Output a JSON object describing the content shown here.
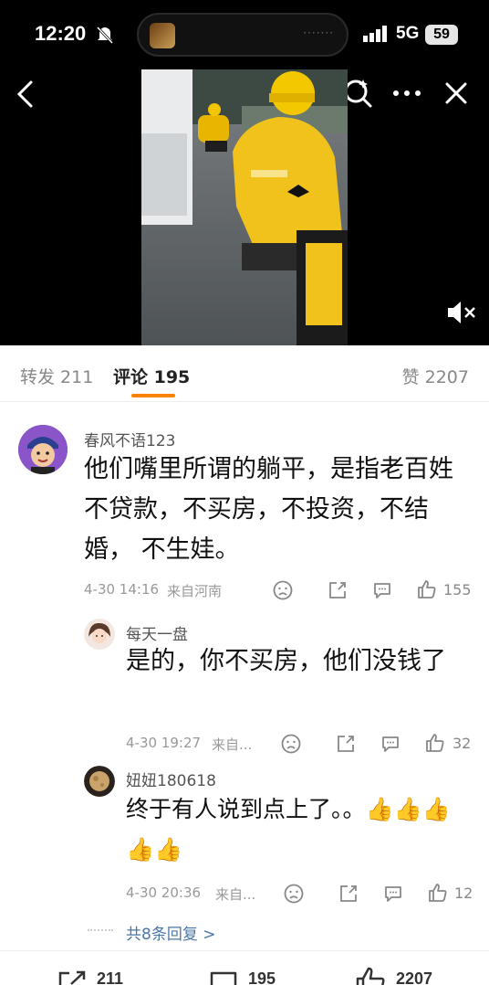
{
  "status_bar": {
    "time": "12:20",
    "network": "5G",
    "battery": "59"
  },
  "tabs": {
    "forward": "转发 211",
    "comments": "评论 195",
    "likes": "赞 2207"
  },
  "comment": {
    "user": "春风不语123",
    "text": "他们嘴里所谓的躺平，是指老百姓不贷款，不买房，不投资，不结婚， 不生娃。",
    "time": "4-30 14:16",
    "location": "来自河南",
    "likes": "155",
    "replies": [
      {
        "user": "每天一盘",
        "text": "是的，你不买房，他们没钱了",
        "time": "4-30 19:27",
        "location": "来自...",
        "likes": "32"
      },
      {
        "user": "妞妞180618",
        "text": "终于有人说到点上了。。👍👍👍👍👍",
        "time": "4-30 20:36",
        "location": "来自...",
        "likes": "12"
      }
    ],
    "more_replies": "共8条回复 >"
  },
  "bottom_bar": {
    "forward": "211",
    "comments": "195",
    "likes": "2207"
  },
  "colors": {
    "accent": "#ff8200",
    "link": "#4a77a8"
  }
}
